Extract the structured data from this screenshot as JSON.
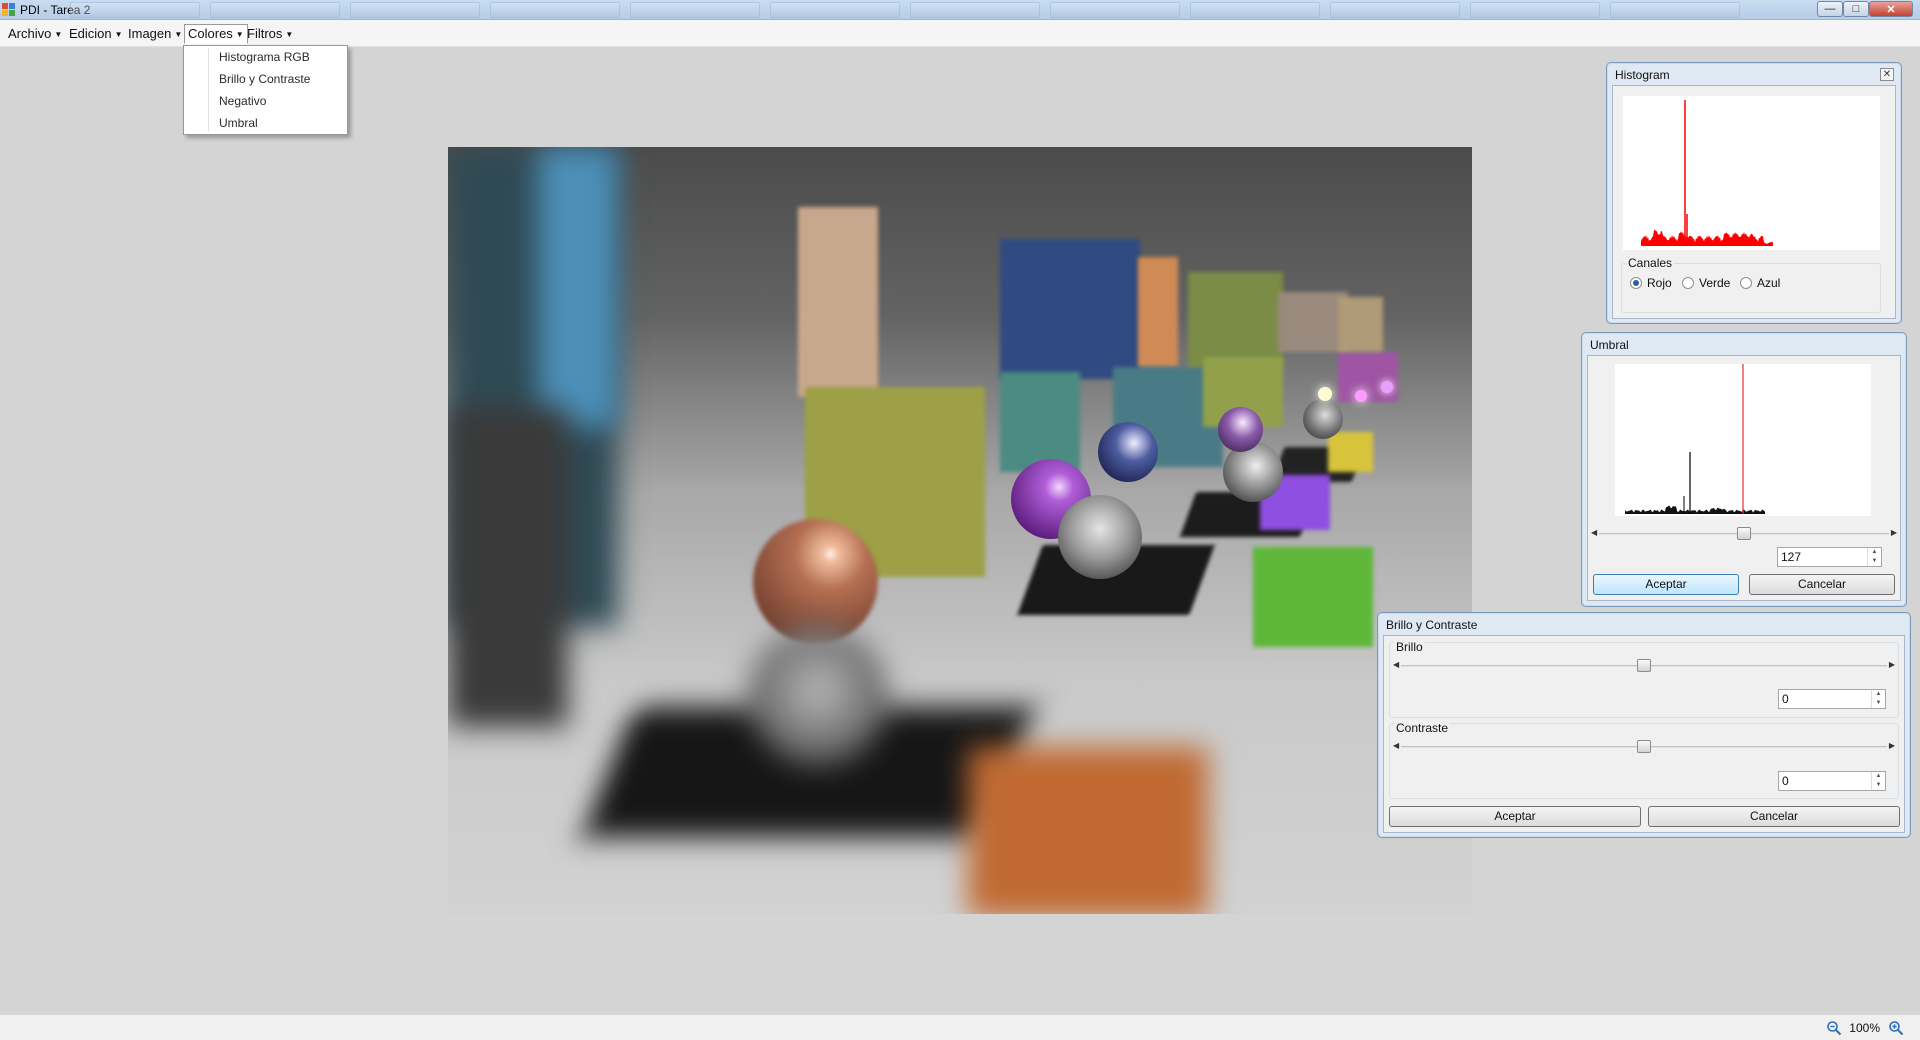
{
  "window": {
    "title": "PDI - Tarea 2",
    "controls": {
      "minimize": "—",
      "maximize": "□",
      "close": "✕"
    }
  },
  "menu": {
    "items": [
      "Archivo",
      "Edicion",
      "Imagen",
      "Colores",
      "Filtros"
    ],
    "open_menu": "Colores",
    "colores_items": [
      "Histograma RGB",
      "Brillo y Contraste",
      "Negativo",
      "Umbral"
    ]
  },
  "histogram_window": {
    "title": "Histogram",
    "close_glyph": "✕",
    "channels_label": "Canales",
    "channels": [
      "Rojo",
      "Verde",
      "Azul"
    ],
    "selected_channel": "Rojo",
    "plot_color": "#ff0000"
  },
  "umbral_window": {
    "title": "Umbral",
    "value": "127",
    "threshold_fraction": 0.5,
    "accept_label": "Aceptar",
    "cancel_label": "Cancelar",
    "marker_color": "#e03030"
  },
  "brillo_window": {
    "title": "Brillo y Contraste",
    "brillo_label": "Brillo",
    "brillo_value": "0",
    "contraste_label": "Contraste",
    "contraste_value": "0",
    "slider_fraction": 0.5,
    "accept_label": "Aceptar",
    "cancel_label": "Cancelar"
  },
  "statusbar": {
    "zoom": "100%"
  },
  "icons": {
    "app": "paint-app-icon",
    "zoom_out": "zoom-out-icon",
    "zoom_in": "zoom-in-icon"
  }
}
